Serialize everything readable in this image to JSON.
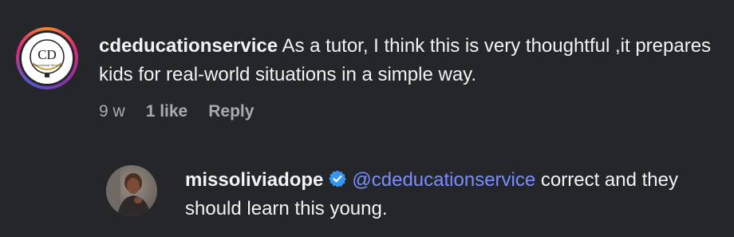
{
  "comment": {
    "avatar_logo_text": "CD",
    "avatar_logo_subtext": "Educational Service",
    "username": "cdeducationservice",
    "text": "As a tutor, I think this is very thoughtful ,it prepares kids for real-world situations in a simple way.",
    "meta": {
      "time": "9 w",
      "likes": "1 like",
      "reply_label": "Reply"
    }
  },
  "reply": {
    "username": "missoliviadope",
    "verified_icon": "verified-badge-icon",
    "mention": "@cdeducationservice",
    "text": "correct and they should learn this young."
  },
  "colors": {
    "background": "#25262a",
    "text": "#f1f2f4",
    "meta": "#a8abb1",
    "mention": "#7a8dff",
    "verified": "#3797f0"
  }
}
